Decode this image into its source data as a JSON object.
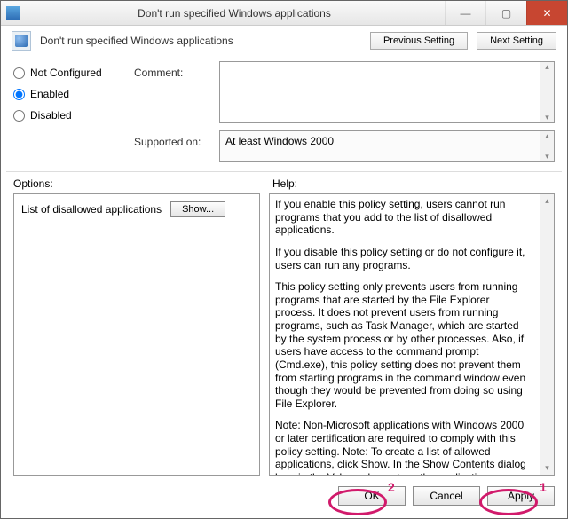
{
  "window": {
    "title": "Don't run specified Windows applications"
  },
  "header": {
    "title": "Don't run specified Windows applications",
    "previous_setting": "Previous Setting",
    "next_setting": "Next Setting"
  },
  "state": {
    "not_configured": "Not Configured",
    "enabled": "Enabled",
    "disabled": "Disabled",
    "selected": "Enabled"
  },
  "labels": {
    "comment": "Comment:",
    "supported_on": "Supported on:",
    "options": "Options:",
    "help": "Help:"
  },
  "supported_on_text": "At least Windows 2000",
  "options_panel": {
    "list_label": "List of disallowed applications",
    "show_button": "Show..."
  },
  "help_paragraphs": [
    "If you enable this policy setting, users cannot run programs that you add to the list of disallowed applications.",
    "If you disable this policy setting or do not configure it, users can run any programs.",
    "This policy setting only prevents users from running programs that are started by the File Explorer process. It does not prevent users from running programs, such as Task Manager, which are started by the system process or by other processes.  Also, if users have access to the command prompt (Cmd.exe), this policy setting does not prevent them from starting programs in the command window even though they would be prevented from doing so using File Explorer.",
    "Note: Non-Microsoft applications with Windows 2000 or later certification are required to comply with this policy setting.\nNote: To create a list of allowed applications, click Show.  In the Show Contents dialog box, in the Value column, type the application executable name (e.g., Winword.exe, Poledit.exe, Powerpnt.exe)."
  ],
  "buttons": {
    "ok": "OK",
    "cancel": "Cancel",
    "apply": "Apply"
  },
  "annotations": {
    "one": "1",
    "two": "2"
  }
}
